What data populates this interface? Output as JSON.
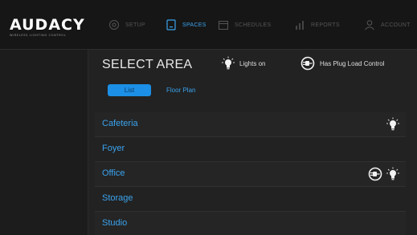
{
  "app": {
    "logo_text": "AUDACY",
    "logo_tagline": "WIRELESS LIGHTING CONTROL"
  },
  "nav": {
    "items": [
      {
        "label": "SETUP",
        "icon": "setup-icon",
        "active": false
      },
      {
        "label": "SPACES",
        "icon": "spaces-icon",
        "active": true
      },
      {
        "label": "SCHEDULES",
        "icon": "schedules-icon",
        "active": false
      },
      {
        "label": "REPORTS",
        "icon": "reports-icon",
        "active": false
      },
      {
        "label": "ACCOUNT",
        "icon": "account-icon",
        "active": false
      }
    ]
  },
  "main": {
    "title": "SELECT AREA",
    "legend": {
      "lights_on": "Lights on",
      "plug_load": "Has Plug Load Control"
    },
    "tabs": [
      {
        "label": "List",
        "active": true
      },
      {
        "label": "Floor Plan",
        "active": false
      }
    ],
    "areas": [
      {
        "name": "Cafeteria",
        "plug_load": false,
        "lights_on": true
      },
      {
        "name": "Foyer",
        "plug_load": false,
        "lights_on": false
      },
      {
        "name": "Office",
        "plug_load": true,
        "lights_on": true
      },
      {
        "name": "Storage",
        "plug_load": false,
        "lights_on": false
      },
      {
        "name": "Studio",
        "plug_load": false,
        "lights_on": false
      }
    ]
  },
  "colors": {
    "accent": "#3aa3ee",
    "active_tab": "#1c90e6",
    "background": "#222222",
    "topbar": "#161616",
    "inactive_nav": "#555555"
  }
}
